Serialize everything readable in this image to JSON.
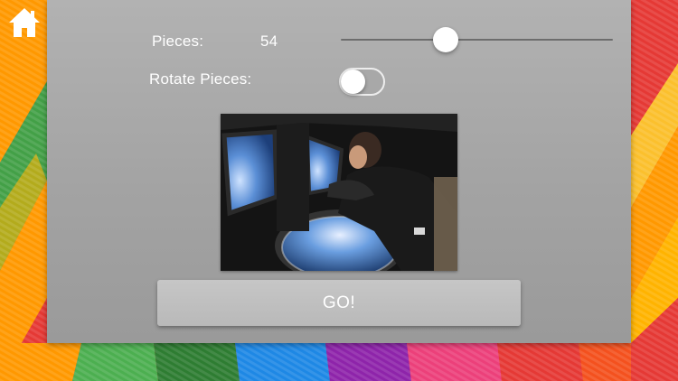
{
  "app": {
    "colors": {
      "panel": "#a9a9a9",
      "text": "#ffffff",
      "stripes": [
        "#ff9800",
        "#4caf50",
        "#1e88e5",
        "#9c27b0",
        "#e91e63",
        "#f44336",
        "#2e7d32",
        "#ffc107"
      ]
    }
  },
  "header": {
    "home_icon": "home-icon"
  },
  "settings": {
    "pieces_label": "Pieces:",
    "pieces_value": "54",
    "pieces_slider_level": 0.385,
    "rotate_label": "Rotate Pieces:",
    "rotate_enabled": false
  },
  "preview": {
    "subject": "astronaut looking out of spacecraft window at Earth"
  },
  "actions": {
    "go_label": "GO!"
  }
}
